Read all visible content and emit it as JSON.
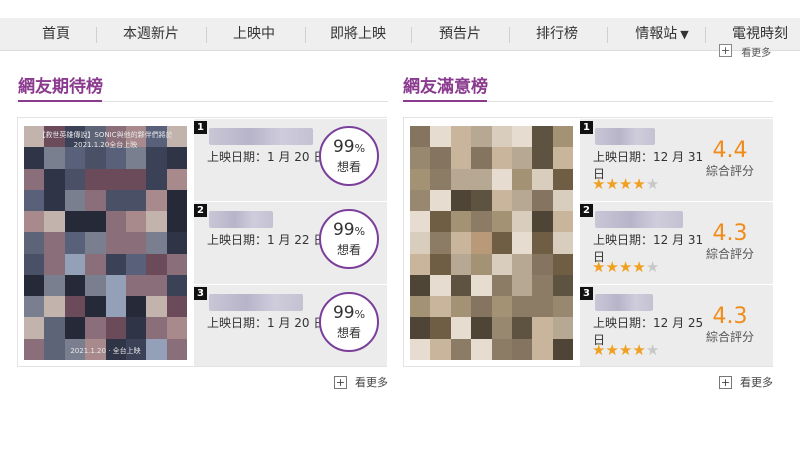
{
  "nav": {
    "items": [
      "首頁",
      "本週新片",
      "上映中",
      "即將上映",
      "預告片",
      "排行榜",
      "情報站",
      "電視時刻"
    ],
    "dropdown_caret": "▼"
  },
  "more_label": "看更多",
  "plus_symbol": "+",
  "anticipated": {
    "title": "網友期待榜",
    "poster_caption_top": "【救世英雄傳說】SONIC與他的夥伴們將於2021.1.20全台上映",
    "poster_caption_bottom": "2021.1.20 · 全台上映",
    "items": [
      {
        "rank": "1",
        "release": "上映日期：1 月 20 日",
        "percent": "99",
        "percent_unit": "%",
        "label": "想看"
      },
      {
        "rank": "2",
        "release": "上映日期：1 月 22 日",
        "percent": "99",
        "percent_unit": "%",
        "label": "想看"
      },
      {
        "rank": "3",
        "release": "上映日期：1 月 20 日",
        "percent": "99",
        "percent_unit": "%",
        "label": "想看"
      }
    ]
  },
  "satisfaction": {
    "title": "網友滿意榜",
    "items": [
      {
        "rank": "1",
        "release_line1": "上映日期：12 月 31",
        "release_line2": "日",
        "score": "4.4",
        "score_label": "綜合評分",
        "stars": 4,
        "stars_max": 5
      },
      {
        "rank": "2",
        "release_line1": "上映日期：12 月 31",
        "release_line2": "日",
        "score": "4.3",
        "score_label": "綜合評分",
        "stars": 4,
        "stars_max": 5
      },
      {
        "rank": "3",
        "release_line1": "上映日期：12 月 25",
        "release_line2": "日",
        "score": "4.3",
        "score_label": "綜合評分",
        "stars": 4,
        "stars_max": 5
      }
    ]
  },
  "colors": {
    "accent_purple": "#8a3a8f",
    "score_orange": "#f08c1a",
    "star_gold": "#f0a020"
  }
}
